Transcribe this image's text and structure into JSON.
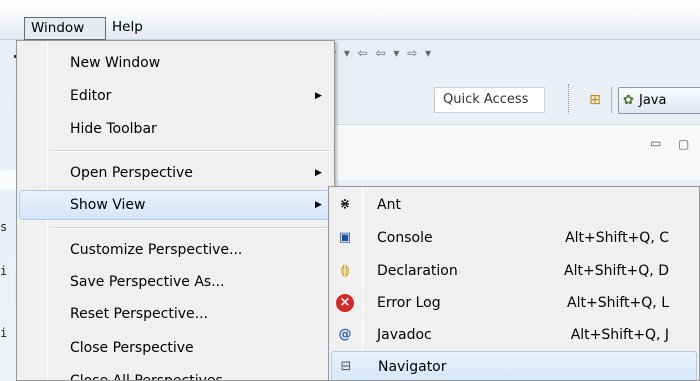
{
  "menubar": {
    "window_label": "Window",
    "help_label": "Help"
  },
  "toolbar": {
    "icons_text": "▾ ▾ ⇦ ⇦ ▾ ⇨ ▾",
    "quick_access_placeholder": "Quick Access",
    "perspective_label": "Java"
  },
  "window_menu": {
    "items": [
      {
        "label": "New Window"
      },
      {
        "label": "Editor",
        "submenu": true
      },
      {
        "label": "Hide Toolbar"
      },
      {
        "label": "Open Perspective",
        "submenu": true
      },
      {
        "label": "Show View",
        "submenu": true,
        "highlighted": true
      },
      {
        "label": "Customize Perspective..."
      },
      {
        "label": "Save Perspective As..."
      },
      {
        "label": "Reset Perspective..."
      },
      {
        "label": "Close Perspective"
      },
      {
        "label": "Close All Perspectives"
      }
    ],
    "submenu_arrow": "▶"
  },
  "show_view_menu": {
    "items": [
      {
        "label": "Ant",
        "shortcut": "",
        "icon": "ant-icon"
      },
      {
        "label": "Console",
        "shortcut": "Alt+Shift+Q, C",
        "icon": "console-icon"
      },
      {
        "label": "Declaration",
        "shortcut": "Alt+Shift+Q, D",
        "icon": "declaration-icon"
      },
      {
        "label": "Error Log",
        "shortcut": "Alt+Shift+Q, L",
        "icon": "error-log-icon"
      },
      {
        "label": "Javadoc",
        "shortcut": "Alt+Shift+Q, J",
        "icon": "javadoc-icon"
      },
      {
        "label": "Navigator",
        "shortcut": "",
        "icon": "navigator-icon",
        "highlighted": true
      }
    ]
  },
  "editor_fragments": [
    "s",
    "i",
    "i"
  ]
}
